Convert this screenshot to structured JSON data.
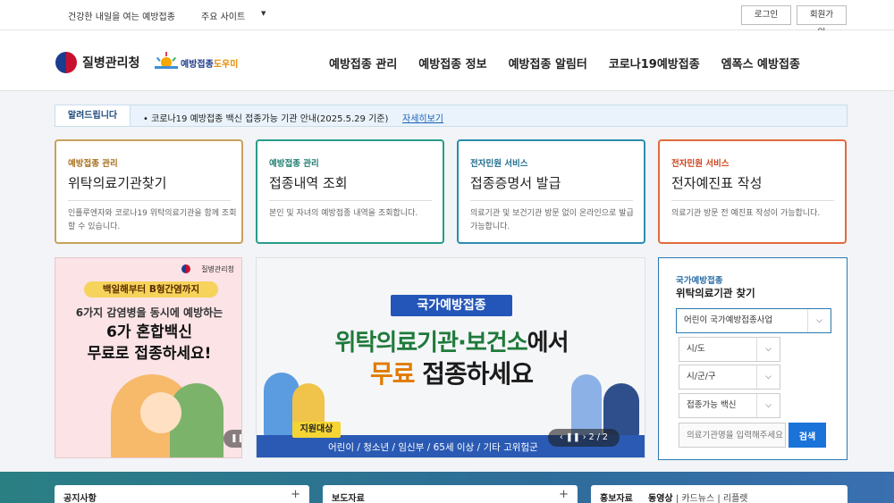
{
  "util": {
    "slogan": "건강한 내일을 여는 예방접종",
    "sites": "주요 사이트",
    "login": "로그인",
    "join": "회원가입"
  },
  "header": {
    "org_name": "질병관리청",
    "helper_logo_main": "예방접종",
    "helper_logo_accent": "도우미",
    "nav": [
      "예방접종 관리",
      "예방접종 정보",
      "예방접종 알림터",
      "코로나19예방접종",
      "엠폭스 예방접종"
    ]
  },
  "notice": {
    "tag": "알려드립니다",
    "message": "• 코로나19 예방접종 백신 접종가능 기관 안내(2025.5.29 기준)",
    "more": "자세히보기"
  },
  "cards": [
    {
      "category": "예방접종 관리",
      "title": "위탁의료기관찾기",
      "desc": "인플루엔자와 코로나19 위탁의료기관을 함께 조회할 수 있습니다."
    },
    {
      "category": "예방접종 관리",
      "title": "접종내역 조회",
      "desc": "본인 및 자녀의 예방접종 내역을 조회합니다."
    },
    {
      "category": "전자민원 서비스",
      "title": "접종증명서 발급",
      "desc": "의료기관 및 보건기관 방문 없이 온라인으로 발급가능합니다."
    },
    {
      "category": "전자민원 서비스",
      "title": "전자예진표 작성",
      "desc": "의료기관 방문 전 예진표 작성이 가능합니다."
    }
  ],
  "banner_left": {
    "org": "질병관리청",
    "pill": "백일해부터 B형간염까지",
    "line1": "6가지 감염병을 동시에 예방하는",
    "line2": "6가 혼합백신",
    "line3": "무료로 접종하세요!",
    "control": "❚❚"
  },
  "banner_center": {
    "label": "국가예방접종",
    "headline1_green": "위탁의료기관·보건소",
    "headline1_rest": "에서",
    "headline2_orange": "무료",
    "headline2_rest": " 접종하세요",
    "target_tag": "지원대상",
    "targets": "어린이 / 청소년 / 임신부 / 65세 이상 / 기타 고위험군",
    "pager": "‹ ❚❚ › 2 / 2"
  },
  "search_panel": {
    "subtitle": "국가예방접종",
    "title": "위탁의료기관 찾기",
    "program_select": "어린이 국가예방접종사업",
    "sido_select": "시/도",
    "sigungu_select": "시/군/구",
    "vaccine_select": "접종가능 백신",
    "input_placeholder": "의료기관명을 입력해주세요",
    "search_button": "검색"
  },
  "bottom": {
    "card1": "공지사항",
    "card2": "보도자료",
    "card3": "홍보자료",
    "card3_tabs": [
      "동영상",
      "카드뉴스",
      "리플렛"
    ]
  },
  "colors": {
    "card1_border": "#c8a25a",
    "card2_border": "#2a9b8a",
    "card3_border": "#2a8dae",
    "card4_border": "#e26a3b",
    "primary_blue": "#1a73d8"
  }
}
